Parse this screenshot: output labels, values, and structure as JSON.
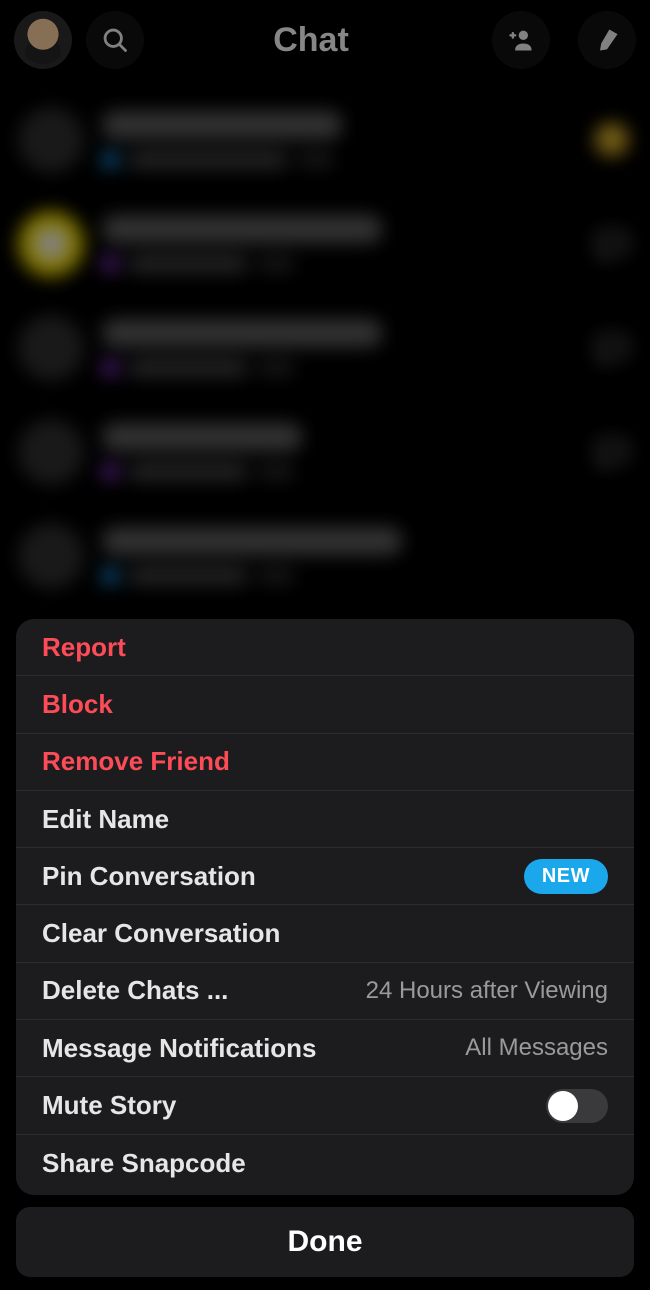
{
  "header": {
    "title": "Chat"
  },
  "row_emoji": "😊",
  "sheet": {
    "report": "Report",
    "block": "Block",
    "remove_friend": "Remove Friend",
    "edit_name": "Edit Name",
    "pin_conversation": "Pin Conversation",
    "pin_badge": "NEW",
    "clear_conversation": "Clear Conversation",
    "delete_chats": "Delete Chats ...",
    "delete_chats_value": "24 Hours after Viewing",
    "message_notifications": "Message Notifications",
    "message_notifications_value": "All Messages",
    "mute_story": "Mute Story",
    "share_snapcode": "Share Snapcode"
  },
  "done": "Done"
}
